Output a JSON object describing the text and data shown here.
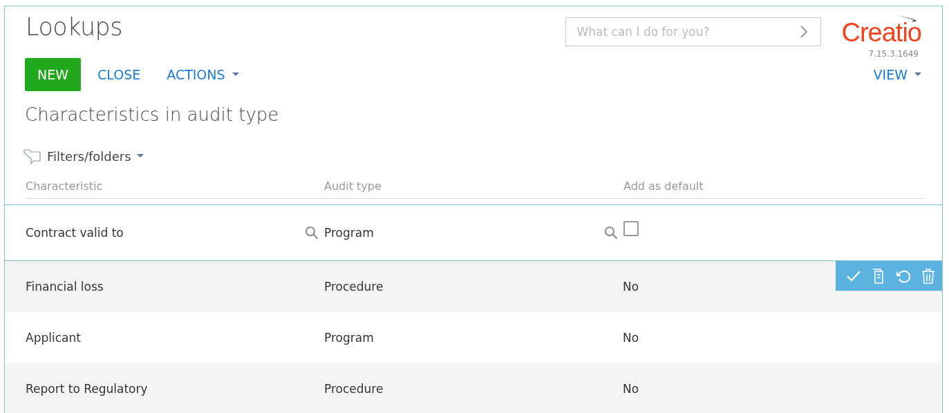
{
  "header": {
    "title": "Lookups",
    "search": {
      "placeholder": "What can I do for you?"
    },
    "logo": "Creatio",
    "version": "7.15.3.1649"
  },
  "toolbar": {
    "buttons": [
      {
        "label": "NEW",
        "kind": "primary"
      },
      {
        "label": "CLOSE",
        "kind": "link"
      },
      {
        "label": "ACTIONS",
        "kind": "menu"
      }
    ],
    "view": "VIEW"
  },
  "section_title": "Characteristics in audit type",
  "filters": "Filters/folders",
  "table": {
    "columns": [
      "Characteristic",
      "Audit type",
      "Add as default"
    ],
    "edit_row": {
      "characteristic": "Contract valid to",
      "audit_type": "Program",
      "add_as_default": false
    },
    "rows": [
      {
        "cells": [
          "Financial loss",
          "Procedure",
          "No"
        ],
        "actions": true
      },
      {
        "cells": [
          "Applicant",
          "Program",
          "No"
        ],
        "actions": false
      },
      {
        "cells": [
          "Report to Regulatory",
          "Procedure",
          "No"
        ],
        "actions": false
      }
    ]
  }
}
